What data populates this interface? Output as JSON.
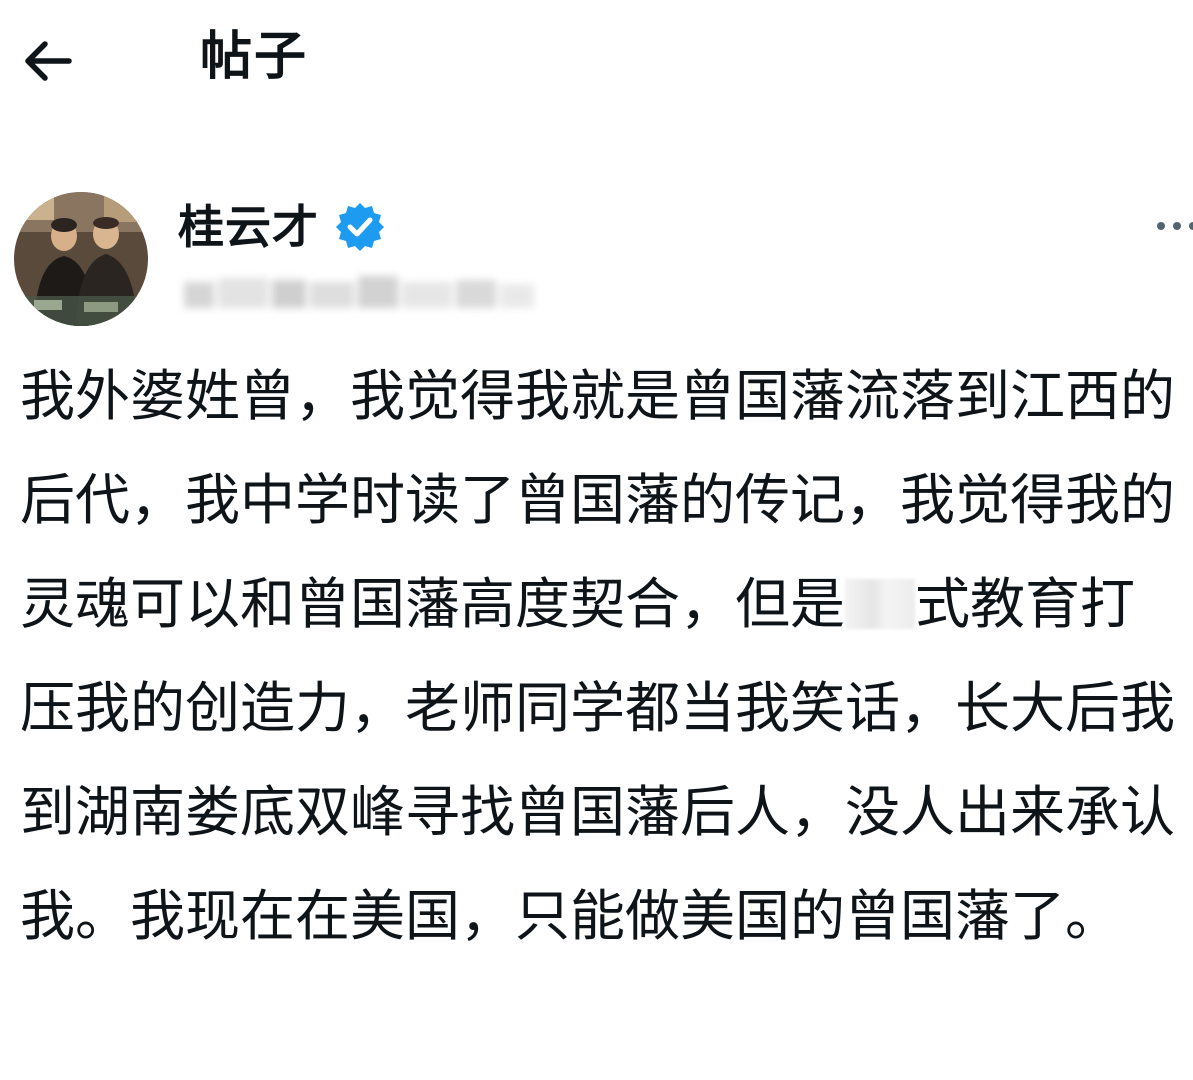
{
  "header": {
    "title": "帖子",
    "back_icon": "arrow-left-icon"
  },
  "author": {
    "name": "桂云才",
    "verified_icon": "verified-badge-icon",
    "verified_color": "#1d9bf0",
    "more_icon": "more-horizontal-icon"
  },
  "post": {
    "text_before_redaction": "我外婆姓曾，我觉得我就是曾国藩流落到江西的后代，我中学时读了曾国藩的传记，我觉得我的灵魂可以和曾国藩高度契合，但是",
    "text_after_redaction": "式教育打压我的创造力，老师同学都当我笑话，长大后我到湖南娄底双峰寻找曾国藩后人，没人出来承认我。我现在在美国，只能做美国的曾国藩了。"
  },
  "colors": {
    "text": "#0f1419",
    "background": "#ffffff",
    "accent": "#1d9bf0"
  }
}
